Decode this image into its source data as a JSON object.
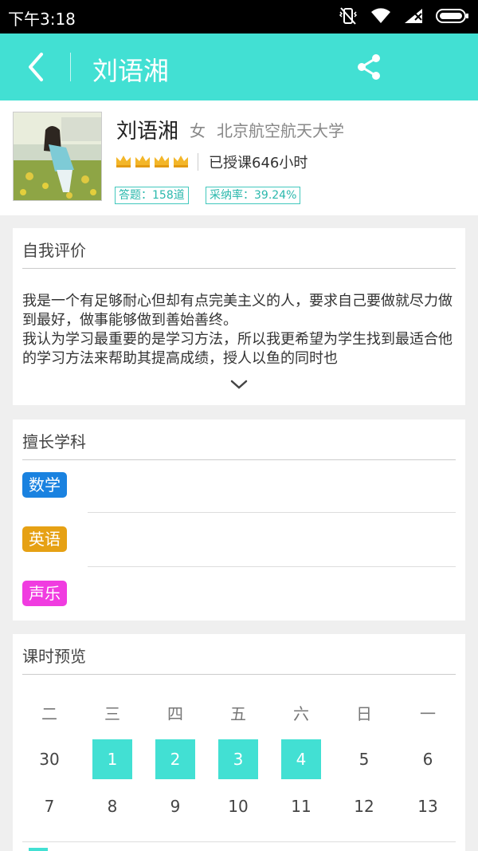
{
  "status_bar": {
    "time": "下午3:18",
    "icons": [
      "vibrate-icon",
      "wifi-icon",
      "signal-icon",
      "battery-icon"
    ]
  },
  "nav": {
    "title": "刘语湘",
    "back_icon": "chevron-left-icon",
    "share_icon": "share-icon"
  },
  "profile": {
    "name": "刘语湘",
    "gender": "女",
    "school": "北京航空航天大学",
    "crown_count": 4,
    "hours_text": "已授课646小时",
    "answers_tag": "答题：158道",
    "adopt_tag": "采纳率：39.24%"
  },
  "self_eval": {
    "title": "自我评价",
    "paragraph1": "我是一个有足够耐心但却有点完美主义的人，要求自己要做就尽力做到最好，做事能够做到善始善终。",
    "paragraph2": "我认为学习最重要的是学习方法，所以我更希望为学生找到最适合他的学习方法来帮助其提高成绩，授人以鱼的同时也",
    "expand_icon": "chevron-down-icon"
  },
  "subjects": {
    "title": "擅长学科",
    "items": [
      {
        "label": "数学",
        "color": "#1a82e0"
      },
      {
        "label": "英语",
        "color": "#e6a114"
      },
      {
        "label": "声乐",
        "color": "#f03ce0"
      }
    ]
  },
  "schedule": {
    "title": "课时预览",
    "weekdays": [
      "二",
      "三",
      "四",
      "五",
      "六",
      "日",
      "一"
    ],
    "week1": [
      "30",
      "1",
      "2",
      "3",
      "4",
      "5",
      "6"
    ],
    "week1_active": [
      false,
      true,
      true,
      true,
      true,
      false,
      false
    ],
    "week2": [
      "7",
      "8",
      "9",
      "10",
      "11",
      "12",
      "13"
    ],
    "accent": "#42e0d3"
  }
}
